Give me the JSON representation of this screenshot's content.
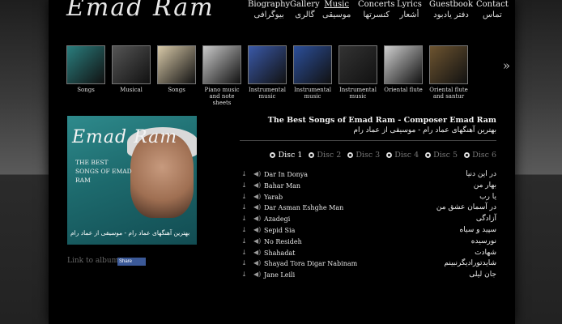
{
  "logo": "Emad Ram",
  "nav": [
    {
      "en": "Biography",
      "fa": "بیوگرافی"
    },
    {
      "en": "Gallery",
      "fa": "گالری"
    },
    {
      "en": "Music",
      "fa": "موسیقی",
      "active": true
    },
    {
      "en": "Concerts",
      "fa": "کنسرتها"
    },
    {
      "en": "Lyrics",
      "fa": "أشعار"
    },
    {
      "en": "Guestbook",
      "fa": "دفتر یادبود"
    },
    {
      "en": "Contact",
      "fa": "تماس"
    }
  ],
  "albums": [
    {
      "caption": "Songs",
      "color": "#2a7e7e"
    },
    {
      "caption": "Musical",
      "color": "#555555"
    },
    {
      "caption": "Songs",
      "color": "#d8c9a8"
    },
    {
      "caption": "Piano music and note sheets",
      "color": "#c9c9c9"
    },
    {
      "caption": "Instrumental music",
      "color": "#3a59a8"
    },
    {
      "caption": "Instrumental music",
      "color": "#2c4f9a"
    },
    {
      "caption": "Instrumental music",
      "color": "#333333"
    },
    {
      "caption": "Oriental flute",
      "color": "#cfcfcf"
    },
    {
      "caption": "Oriental flute and santur",
      "color": "#6d5430"
    }
  ],
  "next_arrow": "»",
  "cover": {
    "title": "Emad Ram",
    "subtitle": "THE BEST SONGS OF EMAD RAM",
    "fa_caption": "بهترین آهنگهای عماد رام - موسیقی از عماد رام"
  },
  "link_to_album": "Link to album",
  "share_label": "Share",
  "album_title_en": "The Best Songs of Emad Ram - Composer Emad Ram",
  "album_title_fa": "بهترین آهنگهای عماد رام - موسیقی از عماد رام",
  "discs": [
    {
      "label": "Disc 1",
      "active": true
    },
    {
      "label": "Disc 2"
    },
    {
      "label": "Disc 3"
    },
    {
      "label": "Disc 4"
    },
    {
      "label": "Disc 5"
    },
    {
      "label": "Disc 6"
    }
  ],
  "tracks": [
    {
      "en": "Dar In Donya",
      "fa": "در این دنیا"
    },
    {
      "en": "Bahar Man",
      "fa": "بهار من"
    },
    {
      "en": "Yarab",
      "fa": "یا رب"
    },
    {
      "en": "Dar Asman Eshghe Man",
      "fa": "در آسمان عشق من"
    },
    {
      "en": "Azadegi",
      "fa": "آزادگی"
    },
    {
      "en": "Sepid Sia",
      "fa": "سپید و سیاه"
    },
    {
      "en": "No Resideh",
      "fa": "نورسیده"
    },
    {
      "en": "Shahadat",
      "fa": "شهادت"
    },
    {
      "en": "Shayad Tora Digar Nabinam",
      "fa": "شایدتورادیگرنبینم"
    },
    {
      "en": "Jane Leili",
      "fa": "جان لیلی"
    }
  ]
}
